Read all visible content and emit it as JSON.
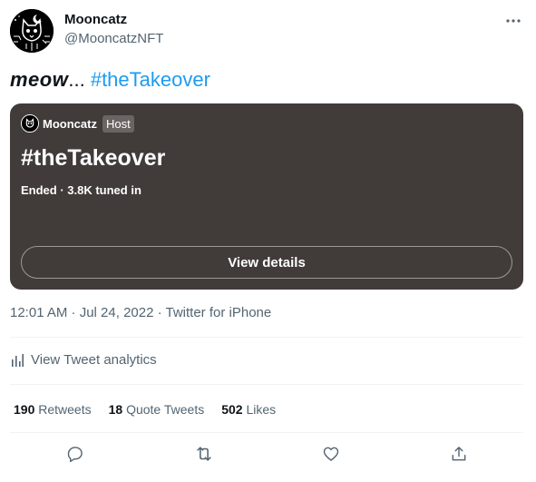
{
  "author": {
    "name": "Mooncatz",
    "handle": "@MooncatzNFT",
    "avatar_icon": "cat-avatar-icon"
  },
  "tweet": {
    "emphasis": "meow",
    "ellipsis": "...",
    "hashtag": "#theTakeover"
  },
  "space_card": {
    "host_name": "Mooncatz",
    "host_badge": "Host",
    "title": "#theTakeover",
    "status": "Ended · 3.8K tuned in",
    "button_label": "View details",
    "background": "#413b39"
  },
  "meta": {
    "timestamp": "12:01 AM · Jul 24, 2022 · Twitter for iPhone"
  },
  "analytics": {
    "label": "View Tweet analytics"
  },
  "stats": [
    {
      "count": "190",
      "label": "Retweets"
    },
    {
      "count": "18",
      "label": "Quote Tweets"
    },
    {
      "count": "502",
      "label": "Likes"
    }
  ],
  "actions": [
    "reply-icon",
    "retweet-icon",
    "like-icon",
    "share-icon"
  ],
  "colors": {
    "link": "#1d9bf0",
    "secondary_text": "#536471",
    "primary_text": "#0f1419"
  }
}
